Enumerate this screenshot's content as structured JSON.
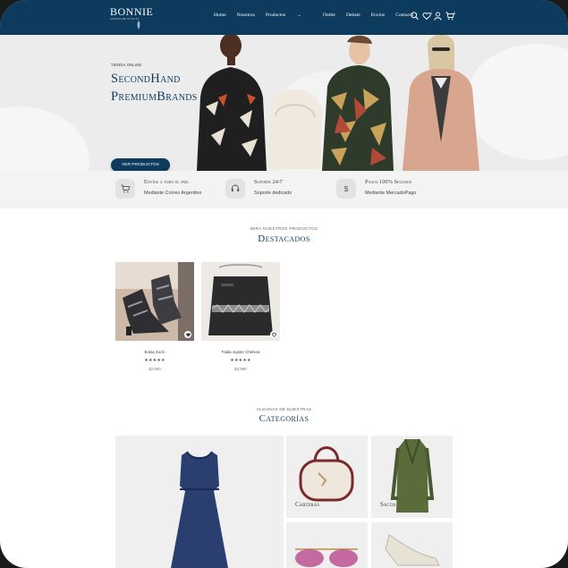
{
  "brand": {
    "name": "BONNIE",
    "tagline": "SIGNATURE OUTFITS"
  },
  "nav": {
    "items": [
      "Home",
      "Nosotros",
      "Productos",
      "Outlet",
      "Debate",
      "Envíos",
      "Contacto"
    ]
  },
  "header_icons": {
    "wishlist_count": "0",
    "cart_count": "0"
  },
  "hero": {
    "kicker": "TIENDA ONLINE",
    "title_line1": "SecondHand",
    "title_line2": "PremiumBrands",
    "button_label": "VER PRODUCTOS"
  },
  "features": [
    {
      "icon": "cart-icon",
      "title": "Envíos a todo el país",
      "subtitle": "Mediante Correo Argentino"
    },
    {
      "icon": "support-icon",
      "title": "Soporte 24/7",
      "subtitle": "Soporte dedicado"
    },
    {
      "icon": "dollar-icon",
      "title": "Pagos 100% Seguros",
      "subtitle": "Mediante MercadoPago"
    }
  ],
  "featured": {
    "kicker": "MIRA NUESTROS PRODUCTOS",
    "title": "Destacados",
    "products": [
      {
        "name": "Botas Zuzzi",
        "rating": 5,
        "price": "$2.900"
      },
      {
        "name": "Falda Jupiter Chelsea",
        "rating": 5,
        "price": "$2.990"
      }
    ]
  },
  "categories": {
    "kicker": "ALGUNAS DE NUESTRAS",
    "title": "Categorías",
    "items": [
      {
        "label": "Carteras"
      },
      {
        "label": "Sacos"
      }
    ]
  },
  "colors": {
    "primary": "#0d3b5e",
    "hero_bg": "#ececec",
    "feature_bg": "#f3f3f3"
  }
}
